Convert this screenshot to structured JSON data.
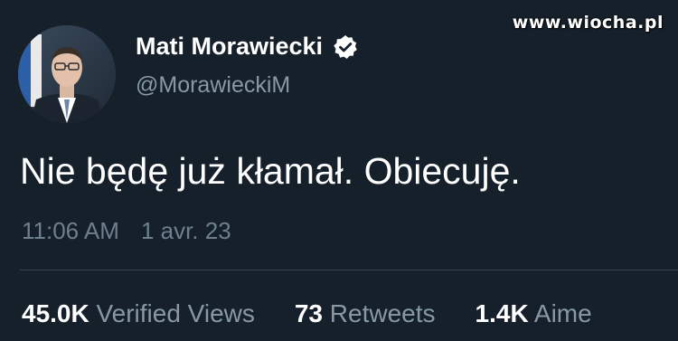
{
  "watermark": "www.wiocha.pl",
  "author": {
    "name": "Mati Morawiecki",
    "handle": "@MorawieckiM",
    "verified_icon": "verified-badge-icon"
  },
  "tweet": {
    "text": "Nie będę już kłamał. Obiecuję.",
    "time": "11:06 AM",
    "date": "1 avr. 23"
  },
  "stats": [
    {
      "value": "45.0K",
      "label": "Verified Views"
    },
    {
      "value": "73",
      "label": "Retweets"
    },
    {
      "value": "1.4K",
      "label": "Aime"
    }
  ],
  "colors": {
    "background": "#15202b",
    "primary_text": "#ffffff",
    "secondary_text": "#8899a6",
    "divider": "#38444d"
  }
}
